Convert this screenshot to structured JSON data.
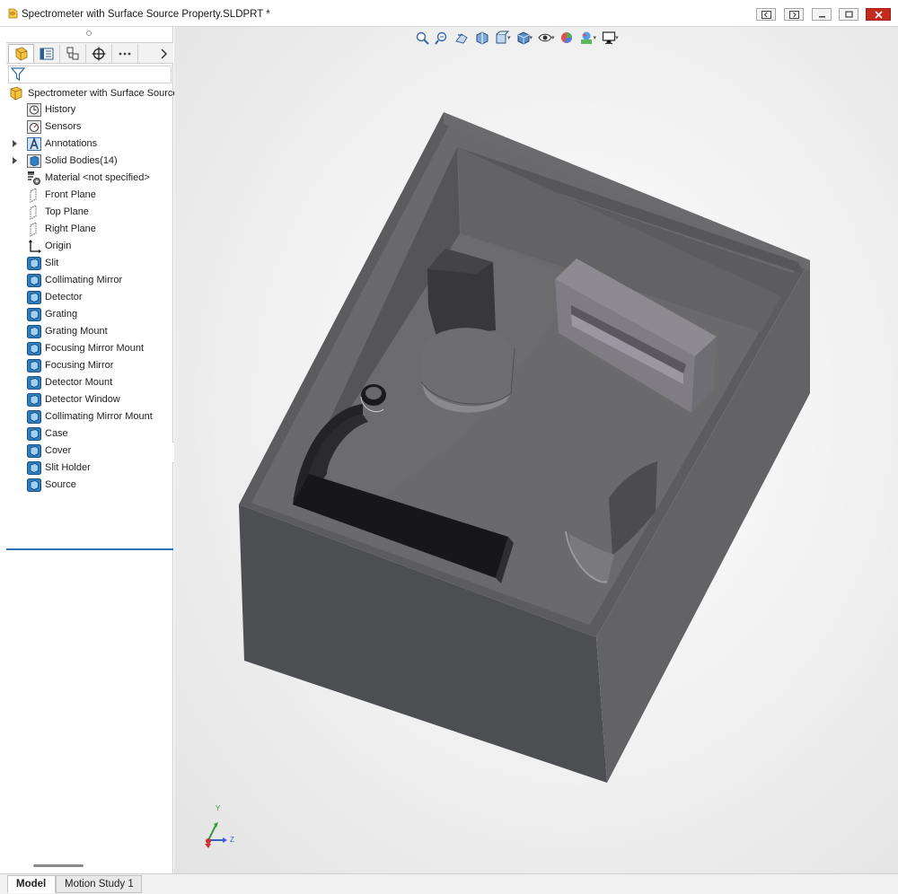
{
  "window": {
    "title": "Spectrometer with Surface Source Property.SLDPRT *"
  },
  "feature_tree": {
    "root": "Spectrometer with Surface Source",
    "items": [
      {
        "label": "History",
        "icon": "history-icon",
        "expandable": false
      },
      {
        "label": "Sensors",
        "icon": "sensors-icon",
        "expandable": false
      },
      {
        "label": "Annotations",
        "icon": "annotations-icon",
        "expandable": true
      },
      {
        "label": "Solid Bodies(14)",
        "icon": "solid-bodies-icon",
        "expandable": true
      },
      {
        "label": "Material <not specified>",
        "icon": "material-icon",
        "expandable": false
      },
      {
        "label": "Front Plane",
        "icon": "plane-icon",
        "expandable": false
      },
      {
        "label": "Top Plane",
        "icon": "plane-icon",
        "expandable": false
      },
      {
        "label": "Right Plane",
        "icon": "plane-icon",
        "expandable": false
      },
      {
        "label": "Origin",
        "icon": "origin-icon",
        "expandable": false
      },
      {
        "label": "Slit",
        "icon": "body-icon",
        "expandable": false
      },
      {
        "label": "Collimating Mirror",
        "icon": "body-icon",
        "expandable": false
      },
      {
        "label": "Detector",
        "icon": "body-icon",
        "expandable": false
      },
      {
        "label": "Grating",
        "icon": "body-icon",
        "expandable": false
      },
      {
        "label": "Grating Mount",
        "icon": "body-icon",
        "expandable": false
      },
      {
        "label": "Focusing Mirror Mount",
        "icon": "body-icon",
        "expandable": false
      },
      {
        "label": "Focusing Mirror",
        "icon": "body-icon",
        "expandable": false
      },
      {
        "label": "Detector Mount",
        "icon": "body-icon",
        "expandable": false
      },
      {
        "label": "Detector Window",
        "icon": "body-icon",
        "expandable": false
      },
      {
        "label": "Collimating Mirror Mount",
        "icon": "body-icon",
        "expandable": false
      },
      {
        "label": "Case",
        "icon": "body-icon",
        "expandable": false
      },
      {
        "label": "Cover",
        "icon": "body-icon",
        "expandable": false
      },
      {
        "label": "Slit Holder",
        "icon": "body-icon",
        "expandable": false
      },
      {
        "label": "Source",
        "icon": "body-icon",
        "expandable": false
      }
    ]
  },
  "panel_tabs": [
    "feature-manager-icon",
    "property-manager-icon",
    "configuration-manager-icon",
    "dimxpert-icon",
    "more-icon"
  ],
  "heads_up_toolbar": [
    "zoom-to-fit-icon",
    "zoom-to-area-icon",
    "previous-view-icon",
    "section-view-icon",
    "view-orientation-icon",
    "display-style-icon",
    "hide-show-items-icon",
    "edit-appearance-icon",
    "apply-scene-icon",
    "view-settings-icon"
  ],
  "triad": {
    "y_label": "Y",
    "z_label": "Z"
  },
  "bottom_tabs": {
    "model": "Model",
    "motion": "Motion Study 1"
  },
  "colors": {
    "accent": "#2e73b8",
    "close": "#c42b1c",
    "body_icon": "#2f7fc1"
  }
}
